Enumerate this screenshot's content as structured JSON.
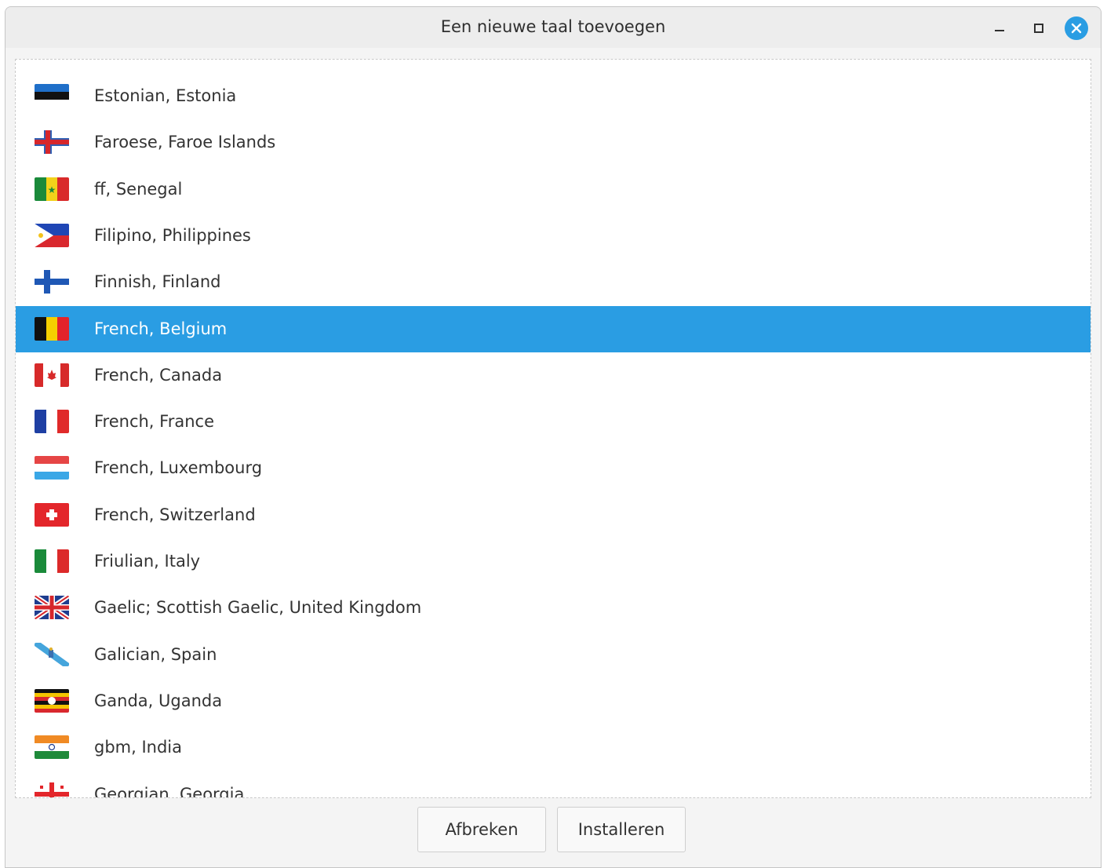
{
  "window": {
    "title": "Een nieuwe taal toevoegen",
    "accent_color": "#2a9de3"
  },
  "languages": [
    {
      "label": "Estonian, Estonia",
      "flag": "estonia-flag-icon"
    },
    {
      "label": "Faroese, Faroe Islands",
      "flag": "faroe-islands-flag-icon"
    },
    {
      "label": "ff, Senegal",
      "flag": "senegal-flag-icon"
    },
    {
      "label": "Filipino, Philippines",
      "flag": "philippines-flag-icon"
    },
    {
      "label": "Finnish, Finland",
      "flag": "finland-flag-icon"
    },
    {
      "label": "French, Belgium",
      "flag": "belgium-flag-icon",
      "selected": true
    },
    {
      "label": "French, Canada",
      "flag": "canada-flag-icon"
    },
    {
      "label": "French, France",
      "flag": "france-flag-icon"
    },
    {
      "label": "French, Luxembourg",
      "flag": "luxembourg-flag-icon"
    },
    {
      "label": "French, Switzerland",
      "flag": "switzerland-flag-icon"
    },
    {
      "label": "Friulian, Italy",
      "flag": "italy-flag-icon"
    },
    {
      "label": "Gaelic; Scottish Gaelic, United Kingdom",
      "flag": "united-kingdom-flag-icon"
    },
    {
      "label": "Galician, Spain",
      "flag": "galicia-flag-icon"
    },
    {
      "label": "Ganda, Uganda",
      "flag": "uganda-flag-icon"
    },
    {
      "label": "gbm, India",
      "flag": "india-flag-icon"
    },
    {
      "label": "Georgian, Georgia",
      "flag": "georgia-flag-icon"
    }
  ],
  "buttons": {
    "cancel": "Afbreken",
    "install": "Installeren"
  }
}
